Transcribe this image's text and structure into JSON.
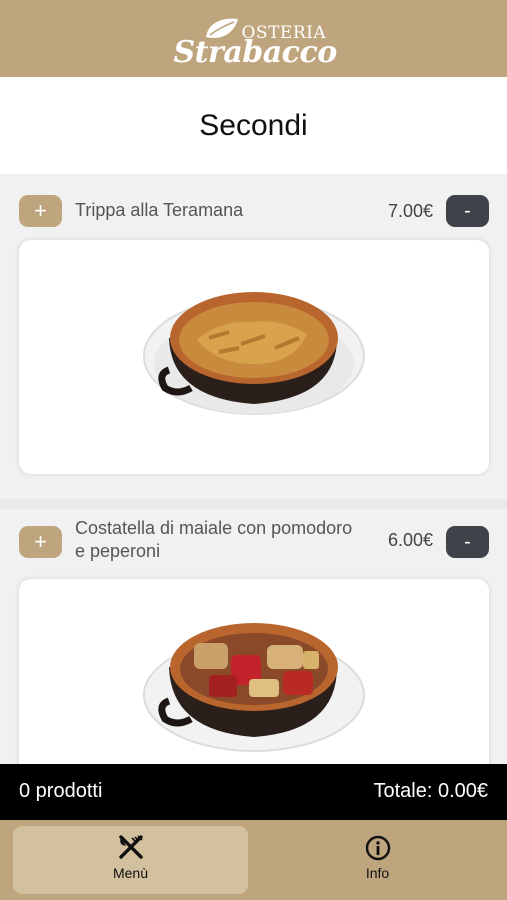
{
  "header": {
    "logo_top": "OSTERIA",
    "logo_bottom": "Strabacco"
  },
  "page": {
    "title": "Secondi"
  },
  "products": [
    {
      "name": "Trippa alla Teramana",
      "price": "7.00€",
      "add_label": "+",
      "remove_label": "-"
    },
    {
      "name": "Costatella di maiale con pomodoro e peperoni",
      "price": "6.00€",
      "add_label": "+",
      "remove_label": "-"
    }
  ],
  "cart": {
    "count": "0 prodotti",
    "total": "Totale: 0.00€"
  },
  "tabs": [
    {
      "label": "Menù",
      "icon": "fork-knife-icon",
      "active": true
    },
    {
      "label": "Info",
      "icon": "info-icon",
      "active": false
    }
  ],
  "colors": {
    "brand": "#bfa57e",
    "active_tab": "#d3c09f",
    "minus_button": "#3e4349",
    "cart_bar": "#000000"
  }
}
